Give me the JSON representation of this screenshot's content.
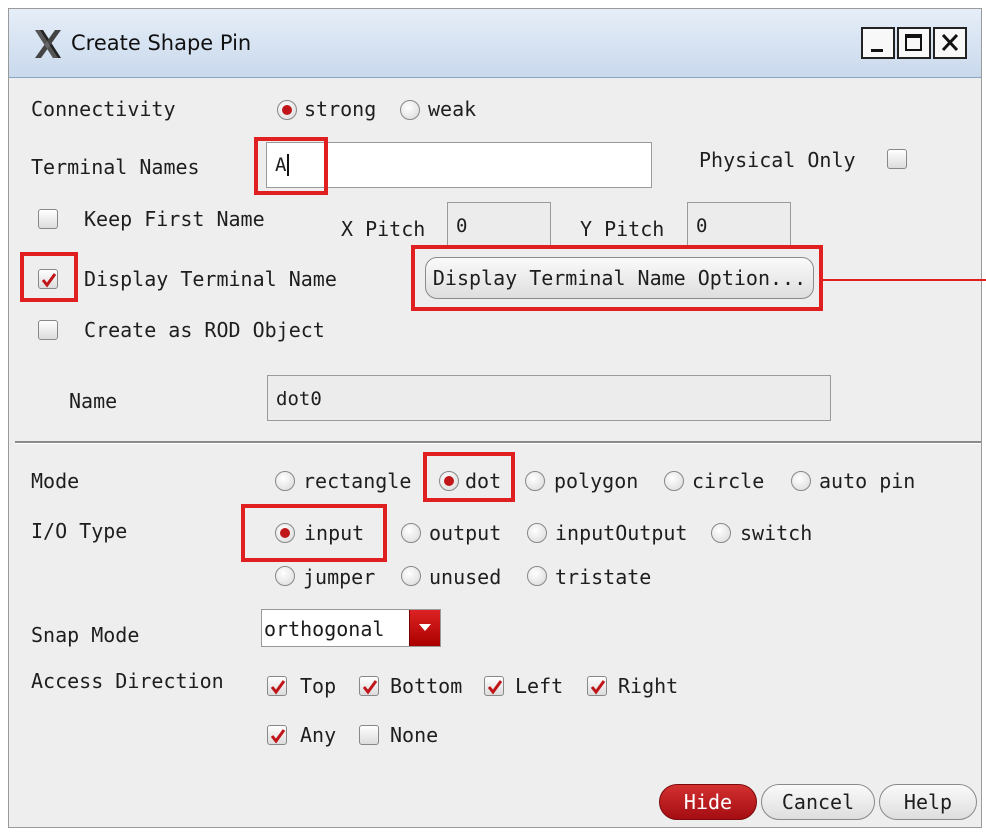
{
  "window": {
    "title": "Create Shape Pin",
    "buttons": [
      "minimize",
      "maximize",
      "close"
    ]
  },
  "connectivity": {
    "label": "Connectivity",
    "options": [
      {
        "label": "strong",
        "selected": true
      },
      {
        "label": "weak",
        "selected": false
      }
    ]
  },
  "terminal_names": {
    "label": "Terminal Names",
    "value": "A",
    "physical_only_label": "Physical Only",
    "physical_only_checked": false
  },
  "keep_first_name": {
    "label": "Keep First Name",
    "checked": false
  },
  "x_pitch": {
    "label": "X Pitch",
    "value": "0"
  },
  "y_pitch": {
    "label": "Y Pitch",
    "value": "0"
  },
  "display_terminal_name": {
    "label": "Display Terminal Name",
    "checked": true
  },
  "display_terminal_name_option_button": "Display Terminal Name Option...",
  "create_as_rod": {
    "label": "Create as ROD Object",
    "checked": false
  },
  "name": {
    "label": "Name",
    "value": "dot0"
  },
  "mode": {
    "label": "Mode",
    "options": [
      {
        "label": "rectangle",
        "selected": false
      },
      {
        "label": "dot",
        "selected": true
      },
      {
        "label": "polygon",
        "selected": false
      },
      {
        "label": "circle",
        "selected": false
      },
      {
        "label": "auto pin",
        "selected": false
      }
    ]
  },
  "io_type": {
    "label": "I/O Type",
    "options": [
      {
        "label": "input",
        "selected": true
      },
      {
        "label": "output",
        "selected": false
      },
      {
        "label": "inputOutput",
        "selected": false
      },
      {
        "label": "switch",
        "selected": false
      },
      {
        "label": "jumper",
        "selected": false
      },
      {
        "label": "unused",
        "selected": false
      },
      {
        "label": "tristate",
        "selected": false
      }
    ]
  },
  "snap_mode": {
    "label": "Snap Mode",
    "value": "orthogonal"
  },
  "access_direction": {
    "label": "Access Direction",
    "options": [
      {
        "label": "Top",
        "checked": true
      },
      {
        "label": "Bottom",
        "checked": true
      },
      {
        "label": "Left",
        "checked": true
      },
      {
        "label": "Right",
        "checked": true
      },
      {
        "label": "Any",
        "checked": true
      },
      {
        "label": "None",
        "checked": false
      }
    ]
  },
  "footer": {
    "hide_label": "Hide",
    "cancel_label": "Cancel",
    "help_label": "Help"
  },
  "colors": {
    "accent_red": "#c0161a",
    "highlight_red": "#e02020",
    "title_bar": "#c9d9ec"
  }
}
